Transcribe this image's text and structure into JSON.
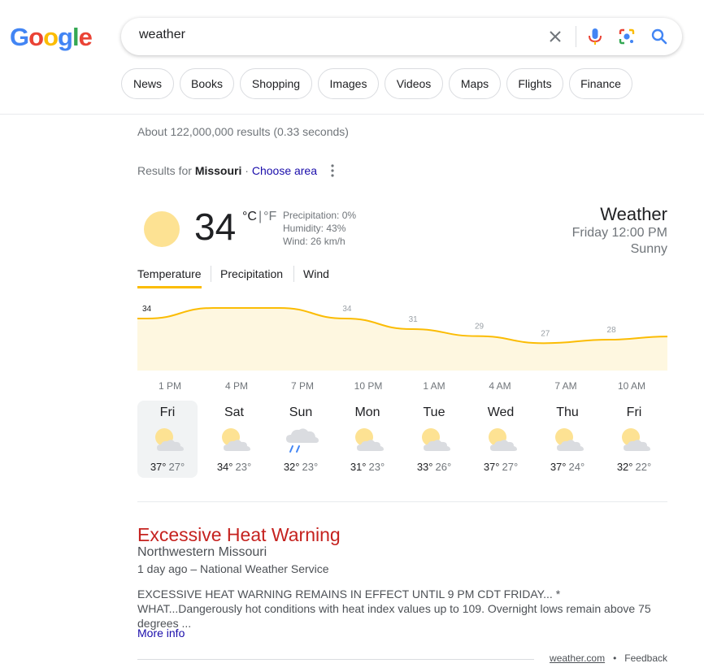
{
  "header": {
    "logo_letters": [
      {
        "ch": "G",
        "color": "#4285F4"
      },
      {
        "ch": "o",
        "color": "#EA4335"
      },
      {
        "ch": "o",
        "color": "#FBBC05"
      },
      {
        "ch": "g",
        "color": "#4285F4"
      },
      {
        "ch": "l",
        "color": "#34A853"
      },
      {
        "ch": "e",
        "color": "#EA4335"
      }
    ],
    "search_value": "weather",
    "icons": [
      "clear-icon",
      "microphone-icon",
      "lens-icon",
      "search-icon"
    ]
  },
  "chips": [
    "News",
    "Books",
    "Shopping",
    "Images",
    "Videos",
    "Maps",
    "Flights",
    "Finance"
  ],
  "stats": "About 122,000,000 results (0.33 seconds)",
  "location": {
    "prefix": "Results for ",
    "place": "Missouri",
    "separator": " · ",
    "link": "Choose area"
  },
  "weather": {
    "temp": "34",
    "unit_c": "°C",
    "unit_sep": "|",
    "unit_f": "°F",
    "precipitation": "Precipitation: 0%",
    "humidity": "Humidity: 43%",
    "wind": "Wind: 26 km/h",
    "title": "Weather",
    "time": "Friday 12:00 PM",
    "condition": "Sunny",
    "tabs": [
      "Temperature",
      "Precipitation",
      "Wind"
    ],
    "colors": {
      "sun": "#fde293",
      "line": "#fbbc04",
      "fill": "#fef7e0"
    }
  },
  "chart_data": {
    "type": "area",
    "temps": [
      34,
      37,
      37,
      34,
      31,
      29,
      27,
      28
    ],
    "time_labels": [
      "1 PM",
      "4 PM",
      "7 PM",
      "10 PM",
      "1 AM",
      "4 AM",
      "7 AM",
      "10 AM"
    ]
  },
  "days": [
    {
      "name": "Fri",
      "hi": "37°",
      "lo": "27°",
      "icon": "partly-cloudy-icon"
    },
    {
      "name": "Sat",
      "hi": "34°",
      "lo": "23°",
      "icon": "partly-cloudy-icon"
    },
    {
      "name": "Sun",
      "hi": "32°",
      "lo": "23°",
      "icon": "rain-cloud-icon"
    },
    {
      "name": "Mon",
      "hi": "31°",
      "lo": "23°",
      "icon": "partly-cloudy-icon"
    },
    {
      "name": "Tue",
      "hi": "33°",
      "lo": "26°",
      "icon": "partly-cloudy-icon"
    },
    {
      "name": "Wed",
      "hi": "37°",
      "lo": "27°",
      "icon": "partly-cloudy-icon"
    },
    {
      "name": "Thu",
      "hi": "37°",
      "lo": "24°",
      "icon": "partly-cloudy-icon"
    },
    {
      "name": "Fri",
      "hi": "32°",
      "lo": "22°",
      "icon": "partly-cloudy-icon"
    }
  ],
  "alert": {
    "title": "Excessive Heat Warning",
    "region": "Northwestern Missouri",
    "meta": "1 day ago – National Weather Service",
    "text": "EXCESSIVE HEAT WARNING REMAINS IN EFFECT UNTIL 9 PM CDT FRIDAY... * WHAT...Dangerously hot conditions with heat index values up to 109. Overnight lows remain above 75 degrees ...",
    "more": "More info"
  },
  "footer": {
    "source": "weather.com",
    "dot": "•",
    "feedback": "Feedback"
  }
}
